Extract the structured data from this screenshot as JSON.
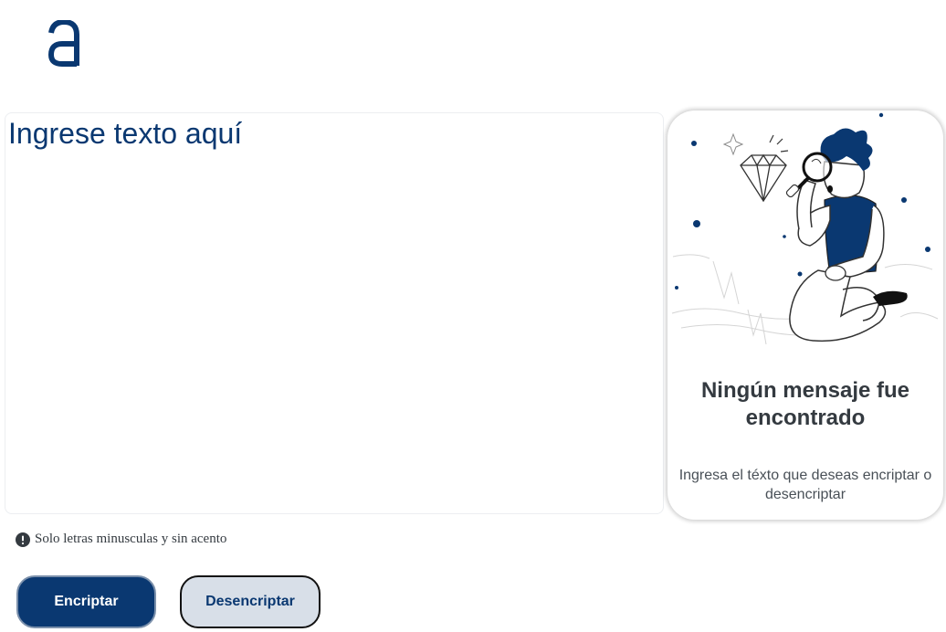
{
  "logo": {
    "icon": "alura-a-logo-icon",
    "color": "#0a3871"
  },
  "input": {
    "placeholder": "Ingrese texto aquí",
    "value": ""
  },
  "notice": {
    "icon": "exclamation-circle-icon",
    "text": "Solo letras minusculas y sin acento"
  },
  "buttons": {
    "encrypt_label": "Encriptar",
    "decrypt_label": "Desencriptar"
  },
  "result": {
    "illustration": "person-with-magnifier-illustration",
    "title": "Ningún mensaje fue encontrado",
    "subtitle": "Ingresa el téxto que deseas encriptar o desencriptar"
  },
  "colors": {
    "primary": "#0a3871",
    "secondary_button": "#d8dfe8",
    "text_dark": "#343a40",
    "text_muted": "#495057"
  }
}
